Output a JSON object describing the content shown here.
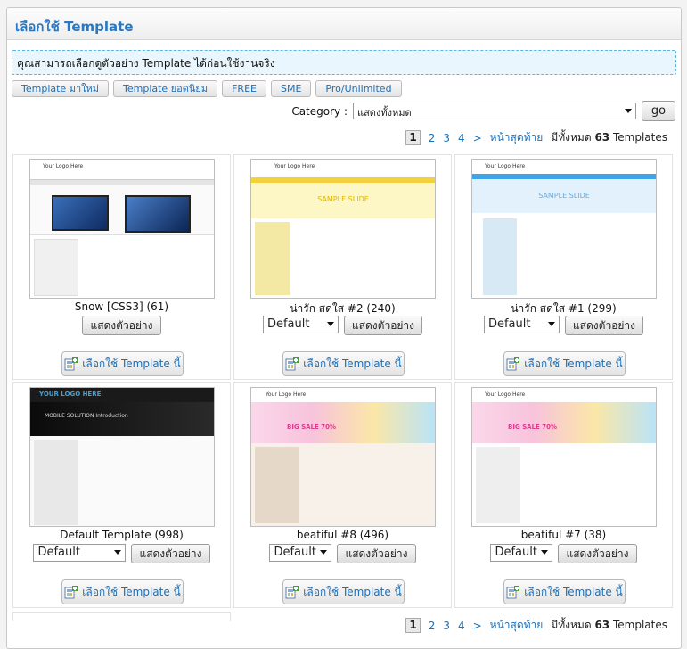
{
  "header": {
    "title": "เลือกใช้ Template"
  },
  "notice": {
    "text": "คุณสามารถเลือกดูตัวอย่าง Template ได้ก่อนใช้งานจริง"
  },
  "tabs": [
    {
      "label": "Template มาใหม่"
    },
    {
      "label": "Template ยอดนิยม"
    },
    {
      "label": "FREE"
    },
    {
      "label": "SME"
    },
    {
      "label": "Pro/Unlimited"
    }
  ],
  "category": {
    "label": "Category :",
    "selected": "แสดงทั้งหมด",
    "go_label": "go"
  },
  "pagination": {
    "current": "1",
    "pages": [
      "2",
      "3",
      "4"
    ],
    "next": ">",
    "last": "หน้าสุดท้าย",
    "total_prefix": "มีทั้งหมด",
    "total_count": "63",
    "total_suffix": "Templates"
  },
  "templates": [
    {
      "title": "Snow [CSS3] (61)",
      "has_select": false,
      "select_value": "",
      "preview_label": "แสดงตัวอย่าง",
      "choose_label": "เลือกใช้ Template นี้",
      "thumb_logo": "Your Logo Here",
      "thumb_style": "snow",
      "thumb_banner": ""
    },
    {
      "title": "น่ารัก สดใส #2 (240)",
      "has_select": true,
      "select_value": "Default",
      "preview_label": "แสดงตัวอย่าง",
      "choose_label": "เลือกใช้ Template นี้",
      "thumb_logo": "Your Logo Here",
      "thumb_style": "yellow",
      "thumb_banner": "SAMPLE SLIDE"
    },
    {
      "title": "น่ารัก สดใส #1 (299)",
      "has_select": true,
      "select_value": "Default",
      "preview_label": "แสดงตัวอย่าง",
      "choose_label": "เลือกใช้ Template นี้",
      "thumb_logo": "Your Logo Here",
      "thumb_style": "blue",
      "thumb_banner": "SAMPLE SLIDE"
    },
    {
      "title": "Default Template (998)",
      "has_select": true,
      "select_value": "Default",
      "preview_label": "แสดงตัวอย่าง",
      "choose_label": "เลือกใช้ Template นี้",
      "thumb_logo": "YOUR LOGO HERE",
      "thumb_style": "dark",
      "thumb_banner": "MOBILE SOLUTION Introduction"
    },
    {
      "title": "beatiful #8 (496)",
      "has_select": true,
      "select_value": "Default",
      "preview_label": "แสดงตัวอย่าง",
      "choose_label": "เลือกใช้ Template นี้",
      "thumb_logo": "Your Logo Here",
      "thumb_style": "pink",
      "thumb_banner": "BIG SALE 70%"
    },
    {
      "title": "beatiful #7 (38)",
      "has_select": true,
      "select_value": "Default",
      "preview_label": "แสดงตัวอย่าง",
      "choose_label": "เลือกใช้ Template นี้",
      "thumb_logo": "Your Logo Here",
      "thumb_style": "pink2",
      "thumb_banner": "BIG SALE 70%"
    }
  ]
}
